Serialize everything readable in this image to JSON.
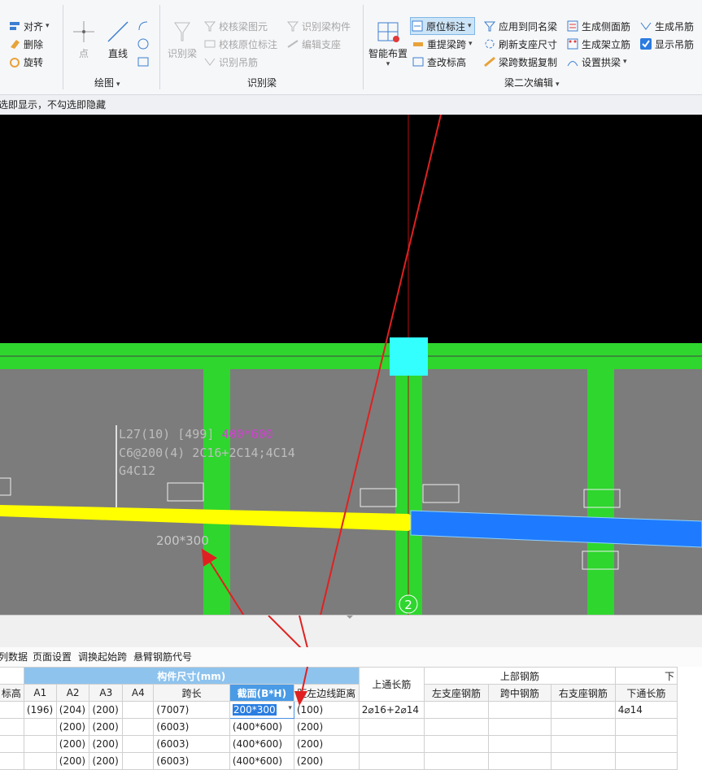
{
  "ribbon": {
    "group1": {
      "align": "对齐",
      "delete": "删除",
      "rotate": "旋转"
    },
    "draw": {
      "point": "点",
      "line": "直线",
      "label": "绘图"
    },
    "identify": {
      "identify_beam": "识别梁",
      "check_beam_elements": "校核梁图元",
      "check_inplace_annotation": "校核原位标注",
      "identify_hanger": "识别吊筋",
      "identify_beam_members": "识别梁构件",
      "edit_support": "编辑支座",
      "label": "识别梁"
    },
    "edit2": {
      "smart_layout": "智能布置",
      "inplace_annotation": "原位标注",
      "relift_span": "重提梁跨",
      "check_elevation": "查改标高",
      "apply_same_name": "应用到同名梁",
      "refresh_support": "刷新支座尺寸",
      "span_data_copy": "梁跨数据复制",
      "gen_side_rebar": "生成侧面筋",
      "gen_frame_rebar": "生成架立筋",
      "set_arch_beam": "设置拱梁",
      "gen_hanger": "生成吊筋",
      "show_hanger": "显示吊筋",
      "label": "梁二次编辑"
    }
  },
  "hint": "选即显示，不勾选即隐藏",
  "canvas": {
    "annotation_lines": [
      "L27(10) [499] ",
      "C6@200(4) 2C16+2C14;4C14",
      "G4C12"
    ],
    "annotation_size": "400*600",
    "section_label": "200*300",
    "axis_number": "2"
  },
  "bottom_toolbar": [
    "列数据",
    "页面设置",
    "调换起始跨",
    "悬臂钢筋代号"
  ],
  "table": {
    "group_headers": {
      "member_size": "构件尺寸(mm)",
      "top_rebar": "上部钢筋",
      "bottom_partial": "下"
    },
    "headers": [
      "标高",
      "A1",
      "A2",
      "A3",
      "A4",
      "跨长",
      "截面(B*H)",
      "距左边线距离",
      "上通长筋",
      "左支座钢筋",
      "跨中钢筋",
      "右支座钢筋",
      "下通长筋"
    ],
    "rows": [
      [
        "",
        "(196)",
        "(204)",
        "(200)",
        "",
        "(7007)",
        "200*300",
        "(100)",
        "2⌀16+2⌀14",
        "",
        "",
        "",
        "4⌀14"
      ],
      [
        "",
        "",
        "(200)",
        "(200)",
        "",
        "(6003)",
        "(400*600)",
        "(200)",
        "",
        "",
        "",
        "",
        ""
      ],
      [
        "",
        "",
        "(200)",
        "(200)",
        "",
        "(6003)",
        "(400*600)",
        "(200)",
        "",
        "",
        "",
        "",
        ""
      ],
      [
        "",
        "",
        "(200)",
        "(200)",
        "",
        "(6003)",
        "(400*600)",
        "(200)",
        "",
        "",
        "",
        "",
        ""
      ]
    ]
  },
  "colors": {
    "beam_green": "#2ed62e",
    "selected_yellow": "#ffff00",
    "selected_blue": "#1e7bff",
    "annotation_red": "#e02020"
  }
}
